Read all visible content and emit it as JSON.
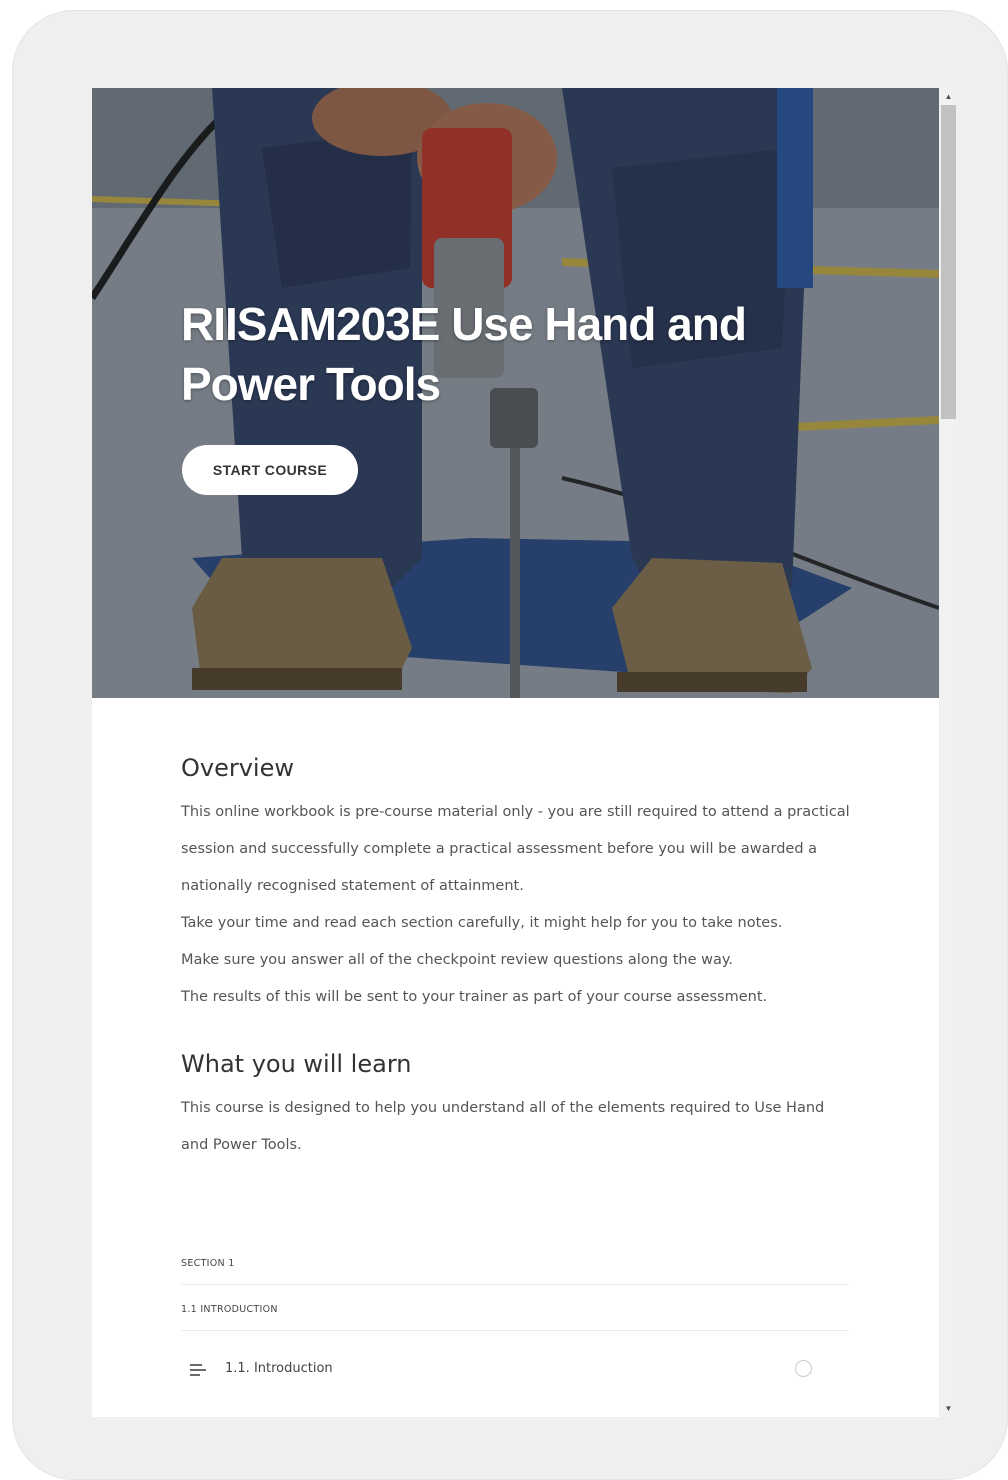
{
  "course": {
    "title": "RIISAM203E Use Hand and Power Tools",
    "start_label": "START COURSE"
  },
  "overview": {
    "heading": "Overview",
    "lines": [
      "This online workbook is pre-course material only - you are still required to attend a practical session and successfully complete a practical assessment before you will be awarded a nationally recognised statement of attainment.",
      "Take your time and read each section carefully, it might help for you to take notes.",
      "Make sure you answer all of the checkpoint review questions along the way.",
      "The results of this will be sent to your trainer as part of your course assessment."
    ]
  },
  "learn": {
    "heading": "What you will learn",
    "text": "This course is designed to help you understand all of the elements required to Use Hand and Power Tools."
  },
  "outline": {
    "section": "SECTION 1",
    "subsection": "1.1 INTRODUCTION",
    "lesson": "1.1. Introduction"
  },
  "icons": {
    "lesson": "text-lines-icon",
    "status": "circle-outline-icon"
  },
  "colors": {
    "frame": "#efefef",
    "text": "#555555",
    "button_bg": "#ffffff"
  }
}
